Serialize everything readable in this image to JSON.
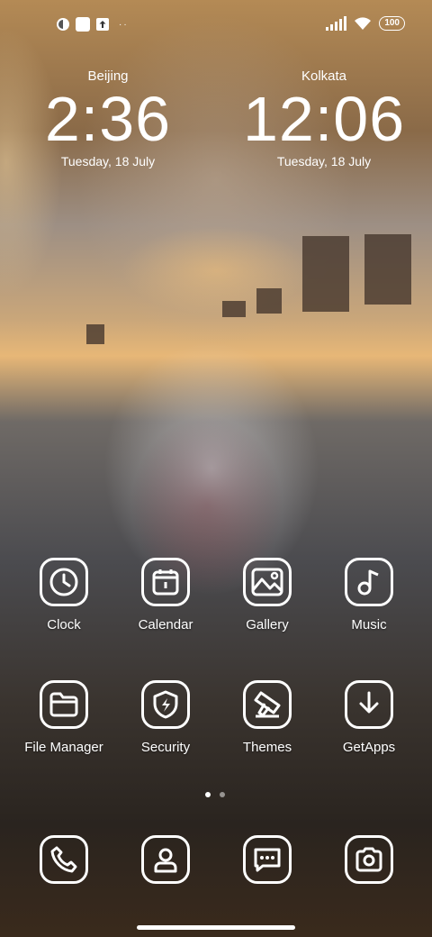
{
  "status_bar": {
    "battery": "100",
    "left_icons": [
      "notification-icon",
      "app-icon",
      "upload-icon"
    ],
    "overflow": "··"
  },
  "clocks": [
    {
      "city": "Beijing",
      "time": "2:36",
      "date": "Tuesday, 18 July"
    },
    {
      "city": "Kolkata",
      "time": "12:06",
      "date": "Tuesday, 18 July"
    }
  ],
  "apps": [
    {
      "label": "Clock",
      "icon": "clock-icon"
    },
    {
      "label": "Calendar",
      "icon": "calendar-icon"
    },
    {
      "label": "Gallery",
      "icon": "gallery-icon"
    },
    {
      "label": "Music",
      "icon": "music-icon"
    },
    {
      "label": "File Manager",
      "icon": "folder-icon"
    },
    {
      "label": "Security",
      "icon": "shield-icon"
    },
    {
      "label": "Themes",
      "icon": "brush-icon"
    },
    {
      "label": "GetApps",
      "icon": "download-icon"
    }
  ],
  "dock": [
    {
      "icon": "phone-icon"
    },
    {
      "icon": "contacts-icon"
    },
    {
      "icon": "messages-icon"
    },
    {
      "icon": "camera-icon"
    }
  ],
  "page_indicator": {
    "pages": 2,
    "current": 1
  }
}
